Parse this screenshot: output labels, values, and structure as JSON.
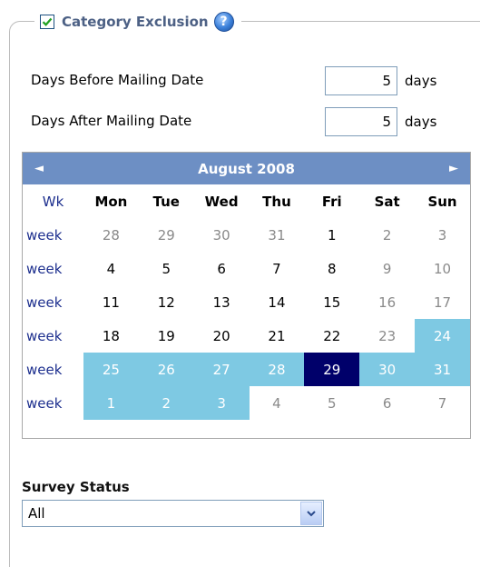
{
  "section": {
    "title": "Category Exclusion",
    "checked": true,
    "help_icon": "help-icon"
  },
  "days_before": {
    "label": "Days Before Mailing Date",
    "value": "5",
    "unit": "days"
  },
  "days_after": {
    "label": "Days After Mailing Date",
    "value": "5",
    "unit": "days"
  },
  "calendar": {
    "title": "August 2008",
    "prev_icon": "◄",
    "next_icon": "►",
    "week_header": "Wk",
    "week_label": "week",
    "day_headers": [
      "Mon",
      "Tue",
      "Wed",
      "Thu",
      "Fri",
      "Sat",
      "Sun"
    ],
    "weeks": [
      [
        {
          "d": "28",
          "s": "other"
        },
        {
          "d": "29",
          "s": "other"
        },
        {
          "d": "30",
          "s": "other"
        },
        {
          "d": "31",
          "s": "other"
        },
        {
          "d": "1",
          "s": "cur"
        },
        {
          "d": "2",
          "s": "other"
        },
        {
          "d": "3",
          "s": "other"
        }
      ],
      [
        {
          "d": "4",
          "s": "cur"
        },
        {
          "d": "5",
          "s": "cur"
        },
        {
          "d": "6",
          "s": "cur"
        },
        {
          "d": "7",
          "s": "cur"
        },
        {
          "d": "8",
          "s": "cur"
        },
        {
          "d": "9",
          "s": "other"
        },
        {
          "d": "10",
          "s": "other"
        }
      ],
      [
        {
          "d": "11",
          "s": "cur"
        },
        {
          "d": "12",
          "s": "cur"
        },
        {
          "d": "13",
          "s": "cur"
        },
        {
          "d": "14",
          "s": "cur"
        },
        {
          "d": "15",
          "s": "cur"
        },
        {
          "d": "16",
          "s": "other"
        },
        {
          "d": "17",
          "s": "other"
        }
      ],
      [
        {
          "d": "18",
          "s": "cur"
        },
        {
          "d": "19",
          "s": "cur"
        },
        {
          "d": "20",
          "s": "cur"
        },
        {
          "d": "21",
          "s": "cur"
        },
        {
          "d": "22",
          "s": "cur"
        },
        {
          "d": "23",
          "s": "other"
        },
        {
          "d": "24",
          "s": "sel"
        }
      ],
      [
        {
          "d": "25",
          "s": "sel"
        },
        {
          "d": "26",
          "s": "sel"
        },
        {
          "d": "27",
          "s": "sel"
        },
        {
          "d": "28",
          "s": "sel"
        },
        {
          "d": "29",
          "s": "today"
        },
        {
          "d": "30",
          "s": "sel"
        },
        {
          "d": "31",
          "s": "sel"
        }
      ],
      [
        {
          "d": "1",
          "s": "sel"
        },
        {
          "d": "2",
          "s": "sel"
        },
        {
          "d": "3",
          "s": "sel"
        },
        {
          "d": "4",
          "s": "other"
        },
        {
          "d": "5",
          "s": "other"
        },
        {
          "d": "6",
          "s": "other"
        },
        {
          "d": "7",
          "s": "other"
        }
      ]
    ],
    "colors": {
      "header_bg": "#6d8fc4",
      "selected_bg": "#7ec9e3",
      "today_bg": "#00006a",
      "week_text": "#1d2f8e"
    }
  },
  "survey_status": {
    "label": "Survey Status",
    "selected": "All"
  }
}
